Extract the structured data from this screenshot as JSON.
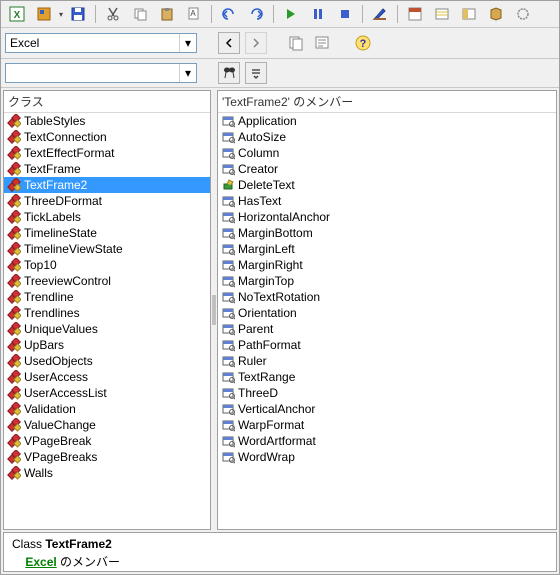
{
  "toolbar1": {
    "icons": [
      "excel",
      "project",
      "save",
      "cut",
      "copy",
      "paste",
      "find",
      "undo",
      "redo",
      "run",
      "pause",
      "reset",
      "stop",
      "design",
      "macro",
      "explorer",
      "props",
      "plugin",
      "unknown"
    ]
  },
  "library_combo": {
    "value": "Excel"
  },
  "search_combo": {
    "value": ""
  },
  "left": {
    "header": "クラス",
    "items": [
      "TableStyles",
      "TextConnection",
      "TextEffectFormat",
      "TextFrame",
      "TextFrame2",
      "ThreeDFormat",
      "TickLabels",
      "TimelineState",
      "TimelineViewState",
      "Top10",
      "TreeviewControl",
      "Trendline",
      "Trendlines",
      "UniqueValues",
      "UpBars",
      "UsedObjects",
      "UserAccess",
      "UserAccessList",
      "Validation",
      "ValueChange",
      "VPageBreak",
      "VPageBreaks",
      "Walls"
    ],
    "selected_index": 4
  },
  "right": {
    "header": "'TextFrame2' のメンバー",
    "items": [
      {
        "t": "prop",
        "n": "Application"
      },
      {
        "t": "prop",
        "n": "AutoSize"
      },
      {
        "t": "prop",
        "n": "Column"
      },
      {
        "t": "prop",
        "n": "Creator"
      },
      {
        "t": "method",
        "n": "DeleteText"
      },
      {
        "t": "prop",
        "n": "HasText"
      },
      {
        "t": "prop",
        "n": "HorizontalAnchor"
      },
      {
        "t": "prop",
        "n": "MarginBottom"
      },
      {
        "t": "prop",
        "n": "MarginLeft"
      },
      {
        "t": "prop",
        "n": "MarginRight"
      },
      {
        "t": "prop",
        "n": "MarginTop"
      },
      {
        "t": "prop",
        "n": "NoTextRotation"
      },
      {
        "t": "prop",
        "n": "Orientation"
      },
      {
        "t": "prop",
        "n": "Parent"
      },
      {
        "t": "prop",
        "n": "PathFormat"
      },
      {
        "t": "prop",
        "n": "Ruler"
      },
      {
        "t": "prop",
        "n": "TextRange"
      },
      {
        "t": "prop",
        "n": "ThreeD"
      },
      {
        "t": "prop",
        "n": "VerticalAnchor"
      },
      {
        "t": "prop",
        "n": "WarpFormat"
      },
      {
        "t": "prop",
        "n": "WordArtformat"
      },
      {
        "t": "prop",
        "n": "WordWrap"
      }
    ]
  },
  "info": {
    "prefix": "Class ",
    "classname": "TextFrame2",
    "library": "Excel",
    "suffix": " のメンバー"
  },
  "colors": {
    "selection": "#3399ff",
    "link": "#008000"
  }
}
